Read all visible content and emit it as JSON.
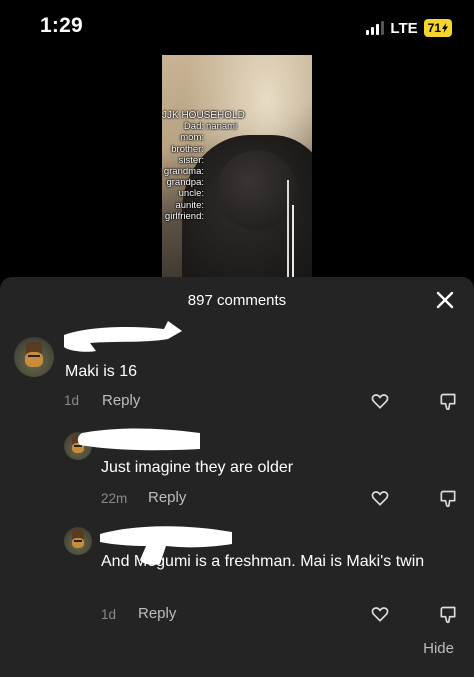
{
  "status_bar": {
    "time": "1:29",
    "network": "LTE",
    "battery": "71"
  },
  "video": {
    "overlay_title": "JJK HOUSEHOLD",
    "overlay_lines": [
      {
        "label": "Dad:",
        "value": "nanami"
      },
      {
        "label": "mom:",
        "value": ""
      },
      {
        "label": "brother:",
        "value": ""
      },
      {
        "label": "sister:",
        "value": ""
      },
      {
        "label": "grandma:",
        "value": ""
      },
      {
        "label": "grandpa:",
        "value": ""
      },
      {
        "label": "uncle:",
        "value": ""
      },
      {
        "label": "aunite:",
        "value": ""
      },
      {
        "label": "girlfriend:",
        "value": ""
      }
    ]
  },
  "sheet": {
    "title": "897 comments",
    "comments": [
      {
        "text": "Maki is 16",
        "time": "1d",
        "reply": "Reply"
      },
      {
        "text": "Just imagine they are older",
        "time": "22m",
        "reply": "Reply"
      },
      {
        "text": "And Megumi is a freshman. Mai is Maki's twin",
        "time": "1d",
        "reply": "Reply"
      }
    ],
    "hide_label": "Hide"
  },
  "colors": {
    "sheet_bg": "#242424",
    "battery": "#f6d32d",
    "muted": "#8a8a8a"
  }
}
